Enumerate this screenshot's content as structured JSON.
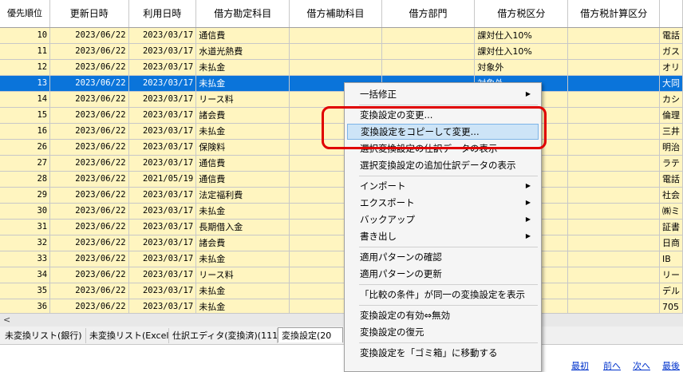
{
  "columns": [
    "優先順位",
    "更新日時",
    "利用日時",
    "借方勘定科目",
    "借方補助科目",
    "借方部門",
    "借方税区分",
    "借方税計算区分",
    ""
  ],
  "rows": [
    {
      "prio": "10",
      "upd": "2023/06/22",
      "use": "2023/03/17",
      "acct": "通信費",
      "tax": "課対仕入10%",
      "extra": "電話"
    },
    {
      "prio": "11",
      "upd": "2023/06/22",
      "use": "2023/03/17",
      "acct": "水道光熱費",
      "tax": "課対仕入10%",
      "extra": "ガス"
    },
    {
      "prio": "12",
      "upd": "2023/06/22",
      "use": "2023/03/17",
      "acct": "未払金",
      "tax": "対象外",
      "extra": "オリ"
    },
    {
      "prio": "13",
      "upd": "2023/06/22",
      "use": "2023/03/17",
      "acct": "未払金",
      "tax": "対象外",
      "extra": "大同"
    },
    {
      "prio": "14",
      "upd": "2023/06/22",
      "use": "2023/03/17",
      "acct": "リース料",
      "tax": "",
      "extra": "カシ"
    },
    {
      "prio": "15",
      "upd": "2023/06/22",
      "use": "2023/03/17",
      "acct": "諸会費",
      "tax": "",
      "extra": "倫理"
    },
    {
      "prio": "16",
      "upd": "2023/06/22",
      "use": "2023/03/17",
      "acct": "未払金",
      "tax": "",
      "extra": "三井"
    },
    {
      "prio": "26",
      "upd": "2023/06/22",
      "use": "2023/03/17",
      "acct": "保険料",
      "tax": "",
      "extra": "明治"
    },
    {
      "prio": "27",
      "upd": "2023/06/22",
      "use": "2023/03/17",
      "acct": "通信費",
      "tax": "",
      "extra": "ラテ"
    },
    {
      "prio": "28",
      "upd": "2023/06/22",
      "use": "2021/05/19",
      "acct": "通信費",
      "tax": "",
      "extra": "電話"
    },
    {
      "prio": "29",
      "upd": "2023/06/22",
      "use": "2023/03/17",
      "acct": "法定福利費",
      "tax": "",
      "extra": "社会"
    },
    {
      "prio": "30",
      "upd": "2023/06/22",
      "use": "2023/03/17",
      "acct": "未払金",
      "tax": "",
      "extra": "㈱ミ"
    },
    {
      "prio": "31",
      "upd": "2023/06/22",
      "use": "2023/03/17",
      "acct": "長期借入金",
      "tax": "",
      "extra": "証書"
    },
    {
      "prio": "32",
      "upd": "2023/06/22",
      "use": "2023/03/17",
      "acct": "諸会費",
      "tax": "",
      "extra": "日商"
    },
    {
      "prio": "33",
      "upd": "2023/06/22",
      "use": "2023/03/17",
      "acct": "未払金",
      "tax": "",
      "extra": "IB"
    },
    {
      "prio": "34",
      "upd": "2023/06/22",
      "use": "2023/03/17",
      "acct": "リース料",
      "tax": "",
      "extra": "リー"
    },
    {
      "prio": "35",
      "upd": "2023/06/22",
      "use": "2023/03/17",
      "acct": "未払金",
      "tax": "",
      "extra": "デル"
    },
    {
      "prio": "36",
      "upd": "2023/06/22",
      "use": "2023/03/17",
      "acct": "未払金",
      "tax": "",
      "extra": "705"
    }
  ],
  "selected_row": "13",
  "scroll_left_glyph": "<",
  "tabs": [
    "未変換リスト(銀行)",
    "未変換リスト(Excel)",
    "仕訳エディタ(変換済)(111)",
    "変換設定(20"
  ],
  "active_tab": "変換設定(20",
  "context_menu": [
    {
      "label": "一括修正",
      "submenu": true
    },
    {
      "sep": true
    },
    {
      "label": "変換設定の変更..."
    },
    {
      "label": "変換設定をコピーして変更...",
      "highlighted": true
    },
    {
      "label": "選択変換設定の仕訳データの表示"
    },
    {
      "label": "選択変換設定の追加仕訳データの表示"
    },
    {
      "sep": true
    },
    {
      "label": "インポート",
      "submenu": true
    },
    {
      "label": "エクスポート",
      "submenu": true
    },
    {
      "label": "バックアップ",
      "submenu": true
    },
    {
      "label": "書き出し",
      "submenu": true
    },
    {
      "sep": true
    },
    {
      "label": "適用パターンの確認"
    },
    {
      "label": "適用パターンの更新"
    },
    {
      "sep": true
    },
    {
      "label": "「比較の条件」が同一の変換設定を表示"
    },
    {
      "sep": true
    },
    {
      "label": "変換設定の有効⇔無効"
    },
    {
      "label": "変換設定の復元"
    },
    {
      "sep": true
    },
    {
      "label": "変換設定を「ゴミ箱」に移動する"
    }
  ],
  "submenu_glyph": "▶",
  "nav": {
    "first": "最初",
    "prev": "前へ",
    "next": "次へ",
    "last": "最後"
  },
  "colors": {
    "selection": "#0a74da",
    "row_bg": "#fff5c0",
    "annotation": "#e00000",
    "menu_highlight": "#cde4f7"
  }
}
